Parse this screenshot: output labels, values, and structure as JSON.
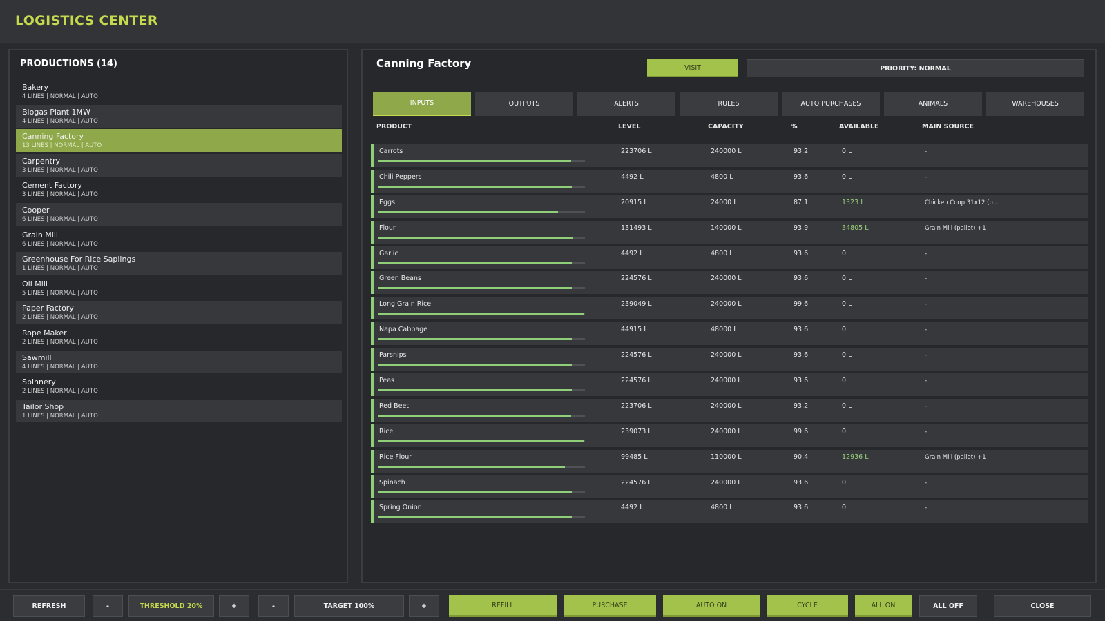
{
  "app": {
    "title": "LOGISTICS CENTER"
  },
  "sidebar": {
    "title": "PRODUCTIONS (14)",
    "items": [
      {
        "name": "Bakery",
        "meta": "4 LINES | NORMAL | AUTO",
        "state": "plain"
      },
      {
        "name": "Biogas Plant 1MW",
        "meta": "4 LINES | NORMAL | AUTO",
        "state": "normal"
      },
      {
        "name": "Canning Factory",
        "meta": "13 LINES | NORMAL | AUTO",
        "state": "active"
      },
      {
        "name": "Carpentry",
        "meta": "3 LINES | NORMAL | AUTO",
        "state": "normal"
      },
      {
        "name": "Cement Factory",
        "meta": "3 LINES | NORMAL | AUTO",
        "state": "plain"
      },
      {
        "name": "Cooper",
        "meta": "6 LINES | NORMAL | AUTO",
        "state": "normal"
      },
      {
        "name": "Grain Mill",
        "meta": "6 LINES | NORMAL | AUTO",
        "state": "plain"
      },
      {
        "name": "Greenhouse For Rice Saplings",
        "meta": "1 LINES | NORMAL | AUTO",
        "state": "normal"
      },
      {
        "name": "Oil Mill",
        "meta": "5 LINES | NORMAL | AUTO",
        "state": "plain"
      },
      {
        "name": "Paper Factory",
        "meta": "2 LINES | NORMAL | AUTO",
        "state": "normal"
      },
      {
        "name": "Rope Maker",
        "meta": "2 LINES | NORMAL | AUTO",
        "state": "plain"
      },
      {
        "name": "Sawmill",
        "meta": "4 LINES | NORMAL | AUTO",
        "state": "normal"
      },
      {
        "name": "Spinnery",
        "meta": "2 LINES | NORMAL | AUTO",
        "state": "plain"
      },
      {
        "name": "Tailor Shop",
        "meta": "1 LINES | NORMAL | AUTO",
        "state": "normal"
      }
    ]
  },
  "main": {
    "title": "Canning Factory",
    "visit_label": "VISIT",
    "priority_label": "PRIORITY: NORMAL",
    "tabs": [
      {
        "label": "INPUTS",
        "active": true
      },
      {
        "label": "OUTPUTS",
        "active": false
      },
      {
        "label": "ALERTS",
        "active": false
      },
      {
        "label": "RULES",
        "active": false
      },
      {
        "label": "AUTO PURCHASES",
        "active": false
      },
      {
        "label": "ANIMALS",
        "active": false
      },
      {
        "label": "WAREHOUSES",
        "active": false
      }
    ],
    "columns": {
      "product": "PRODUCT",
      "level": "LEVEL",
      "capacity": "CAPACITY",
      "percent": "%",
      "available": "AVAILABLE",
      "source": "MAIN SOURCE"
    },
    "rows": [
      {
        "product": "Carrots",
        "level": "223706 L",
        "capacity": "240000 L",
        "percent": "93.2",
        "fill": 0.932,
        "available": "0 L",
        "available_positive": false,
        "source": "-"
      },
      {
        "product": "Chili Peppers",
        "level": "4492 L",
        "capacity": "4800 L",
        "percent": "93.6",
        "fill": 0.936,
        "available": "0 L",
        "available_positive": false,
        "source": "-"
      },
      {
        "product": "Eggs",
        "level": "20915 L",
        "capacity": "24000 L",
        "percent": "87.1",
        "fill": 0.871,
        "available": "1323 L",
        "available_positive": true,
        "source": "Chicken Coop 31x12 (p..."
      },
      {
        "product": "Flour",
        "level": "131493 L",
        "capacity": "140000 L",
        "percent": "93.9",
        "fill": 0.939,
        "available": "34805 L",
        "available_positive": true,
        "source": "Grain Mill (pallet) +1"
      },
      {
        "product": "Garlic",
        "level": "4492 L",
        "capacity": "4800 L",
        "percent": "93.6",
        "fill": 0.936,
        "available": "0 L",
        "available_positive": false,
        "source": "-"
      },
      {
        "product": "Green Beans",
        "level": "224576 L",
        "capacity": "240000 L",
        "percent": "93.6",
        "fill": 0.936,
        "available": "0 L",
        "available_positive": false,
        "source": "-"
      },
      {
        "product": "Long Grain Rice",
        "level": "239049 L",
        "capacity": "240000 L",
        "percent": "99.6",
        "fill": 0.996,
        "available": "0 L",
        "available_positive": false,
        "source": "-"
      },
      {
        "product": "Napa Cabbage",
        "level": "44915 L",
        "capacity": "48000 L",
        "percent": "93.6",
        "fill": 0.936,
        "available": "0 L",
        "available_positive": false,
        "source": "-"
      },
      {
        "product": "Parsnips",
        "level": "224576 L",
        "capacity": "240000 L",
        "percent": "93.6",
        "fill": 0.936,
        "available": "0 L",
        "available_positive": false,
        "source": "-"
      },
      {
        "product": "Peas",
        "level": "224576 L",
        "capacity": "240000 L",
        "percent": "93.6",
        "fill": 0.936,
        "available": "0 L",
        "available_positive": false,
        "source": "-"
      },
      {
        "product": "Red Beet",
        "level": "223706 L",
        "capacity": "240000 L",
        "percent": "93.2",
        "fill": 0.932,
        "available": "0 L",
        "available_positive": false,
        "source": "-"
      },
      {
        "product": "Rice",
        "level": "239073 L",
        "capacity": "240000 L",
        "percent": "99.6",
        "fill": 0.996,
        "available": "0 L",
        "available_positive": false,
        "source": "-"
      },
      {
        "product": "Rice Flour",
        "level": "99485 L",
        "capacity": "110000 L",
        "percent": "90.4",
        "fill": 0.904,
        "available": "12936 L",
        "available_positive": true,
        "source": "Grain Mill (pallet) +1"
      },
      {
        "product": "Spinach",
        "level": "224576 L",
        "capacity": "240000 L",
        "percent": "93.6",
        "fill": 0.936,
        "available": "0 L",
        "available_positive": false,
        "source": "-"
      },
      {
        "product": "Spring Onion",
        "level": "4492 L",
        "capacity": "4800 L",
        "percent": "93.6",
        "fill": 0.936,
        "available": "0 L",
        "available_positive": false,
        "source": "-"
      }
    ]
  },
  "footer": {
    "refresh": "REFRESH",
    "threshold_minus": "-",
    "threshold": "THRESHOLD 20%",
    "threshold_plus": "+",
    "target_minus": "-",
    "target": "TARGET 100%",
    "target_plus": "+",
    "refill": "REFILL",
    "purchase": "PURCHASE",
    "auto_on": "AUTO ON",
    "cycle": "CYCLE",
    "all_on": "ALL ON",
    "all_off": "ALL OFF",
    "close": "CLOSE"
  },
  "colors": {
    "accent": "#c4d94e",
    "active_item": "#8ea84a",
    "button_green": "#a3c24c",
    "level_bar": "#8fcf7a",
    "available_positive": "#9ad07a"
  }
}
